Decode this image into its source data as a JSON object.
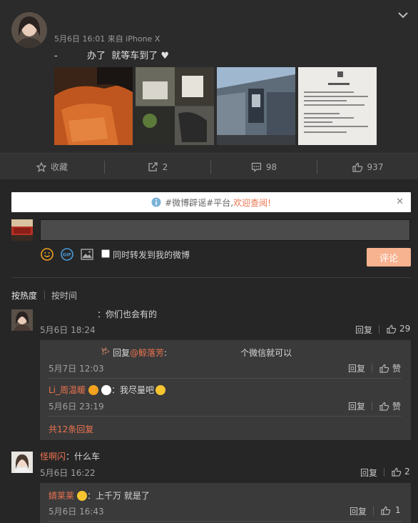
{
  "post": {
    "meta": "5月6日 16:01 来自 iPhone X",
    "text": "-          办了  就等车到了 ♥"
  },
  "actions": {
    "favorite_label": "收藏",
    "repost_count": "2",
    "comment_count": "98",
    "like_count": "937"
  },
  "notice": {
    "text": "#微博辟谣#平台,",
    "link": "欢迎查阅!"
  },
  "composer": {
    "placeholder": "",
    "repost_label": "同时转发到我的微博",
    "submit_label": "评论"
  },
  "sort": {
    "by_hot": "按热度",
    "by_time": "按时间"
  },
  "comments": [
    {
      "text": "：你们也会有的",
      "date": "5月6日 18:24",
      "reply_label": "回复",
      "likes": "29",
      "replies": [
        {
          "prefix": "回复",
          "mention": "@鲸落芳",
          "text": ":                           个微信就可以",
          "date": "5月7日 12:03",
          "reply_label": "回复",
          "like_label": "赞"
        },
        {
          "user": "Li_周温暖",
          "text": "：我尽量吧",
          "date": "5月6日 23:19",
          "reply_label": "回复",
          "like_label": "赞"
        }
      ],
      "more": "共12条回复"
    },
    {
      "user": "怪啊闪",
      "text": "：什么车",
      "date": "5月6日 16:22",
      "reply_label": "回复",
      "likes": "2",
      "replies": [
        {
          "user": "婧莱莱",
          "text": "：上千万 就是了",
          "date": "5月6日 16:43",
          "reply_label": "回复",
          "likes": "1"
        }
      ]
    }
  ],
  "colors": {
    "accent": "#eb7350",
    "submit": "#f7b28f",
    "background": "#262626"
  }
}
